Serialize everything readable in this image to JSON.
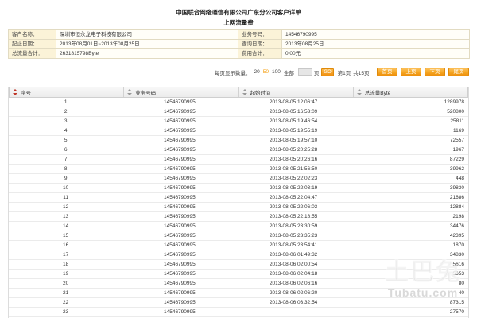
{
  "header": {
    "title": "中国联合网络通信有限公司广东分公司客户详单",
    "subtitle": "上网流量费"
  },
  "info": {
    "customer_name": {
      "label": "客户名称：",
      "value": "深圳市恒永龙电子科技有限公司"
    },
    "service_number": {
      "label": "业务号码：",
      "value": "14546790995"
    },
    "date_range": {
      "label": "起止日期：",
      "value": "2013年08月01日~2013年08月25日"
    },
    "query_date": {
      "label": "查询日期：",
      "value": "2013年08月25日"
    },
    "total_traffic": {
      "label": "总流量合计：",
      "value": "2631815798Byte"
    },
    "total_fee": {
      "label": "费用合计：",
      "value": "0.00元"
    }
  },
  "pagination": {
    "page_size_label": "每页显示数量：",
    "page_sizes": [
      {
        "label": "20",
        "selected": false
      },
      {
        "label": "50",
        "selected": true
      },
      {
        "label": "100",
        "selected": false
      },
      {
        "label": "全部",
        "selected": false
      }
    ],
    "jump_input_value": "",
    "page_unit": "页",
    "go_label": "GO",
    "current_page": "第1页",
    "total_pages": "共15页",
    "first_label": "首页",
    "prev_label": "上页",
    "next_label": "下页",
    "last_label": "尾页"
  },
  "table": {
    "columns": [
      "序号",
      "业务号码",
      "起始时间",
      "总流量Byte"
    ],
    "sorted_column_index": 0,
    "rows": [
      [
        "1",
        "14546790995",
        "2013-08-05 12:06:47",
        "1289978"
      ],
      [
        "2",
        "14546790995",
        "2013-08-05 16:53:09",
        "520800"
      ],
      [
        "3",
        "14546790995",
        "2013-08-05 19:46:54",
        "25811"
      ],
      [
        "4",
        "14546790995",
        "2013-08-05 19:55:19",
        "1169"
      ],
      [
        "5",
        "14546790995",
        "2013-08-05 19:57:10",
        "72557"
      ],
      [
        "6",
        "14546790995",
        "2013-08-05 20:25:28",
        "1967"
      ],
      [
        "7",
        "14546790995",
        "2013-08-05 20:26:16",
        "87229"
      ],
      [
        "8",
        "14546790995",
        "2013-08-05 21:56:50",
        "39962"
      ],
      [
        "9",
        "14546790995",
        "2013-08-05 22:02:23",
        "448"
      ],
      [
        "10",
        "14546790995",
        "2013-08-05 22:03:19",
        "39830"
      ],
      [
        "11",
        "14546790995",
        "2013-08-05 22:04:47",
        "21686"
      ],
      [
        "12",
        "14546790995",
        "2013-08-05 22:06:03",
        "12884"
      ],
      [
        "13",
        "14546790995",
        "2013-08-05 22:18:55",
        "2198"
      ],
      [
        "14",
        "14546790995",
        "2013-08-05 23:30:59",
        "34476"
      ],
      [
        "15",
        "14546790995",
        "2013-08-05 23:35:23",
        "42395"
      ],
      [
        "16",
        "14546790995",
        "2013-08-05 23:54:41",
        "1870"
      ],
      [
        "17",
        "14546790995",
        "2013-08-06 01:49:32",
        "34830"
      ],
      [
        "18",
        "14546790995",
        "2013-08-06 02:00:54",
        "5616"
      ],
      [
        "19",
        "14546790995",
        "2013-08-06 02:04:18",
        "5653"
      ],
      [
        "20",
        "14546790995",
        "2013-08-06 02:06:16",
        "80"
      ],
      [
        "21",
        "14546790995",
        "2013-08-06 02:06:20",
        "40"
      ],
      [
        "22",
        "14546790995",
        "2013-08-06 03:32:54",
        "87315"
      ],
      [
        "23",
        "14546790995",
        "",
        "27570"
      ]
    ]
  },
  "watermark": {
    "brand": "土巴兔",
    "domain": "Tubatu.com"
  },
  "icons": {
    "column_sort": "sort-icon"
  },
  "colors": {
    "accent": "#f39800",
    "button": "#f5a623",
    "label_background": "#fbf3d8",
    "header_background": "#ececec",
    "sort_active": "#c0392b"
  }
}
